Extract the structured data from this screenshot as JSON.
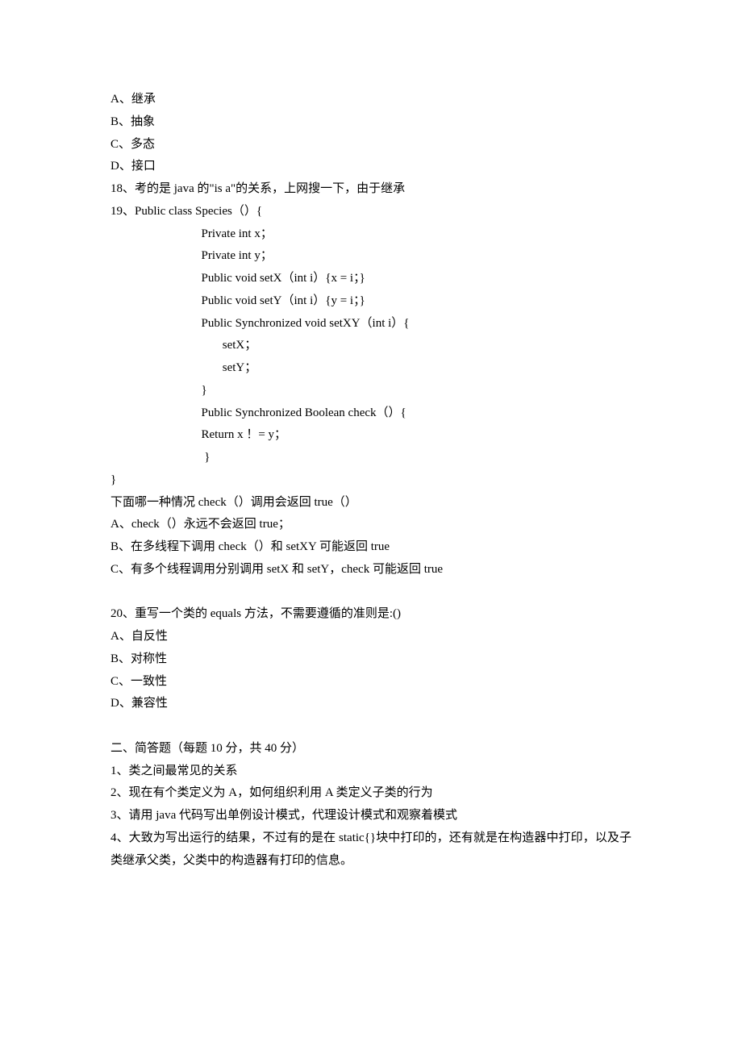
{
  "lines": {
    "l01": "A、继承",
    "l02": "B、抽象",
    "l03": "C、多态",
    "l04": "D、接口",
    "l05": "18、考的是 java 的\"is a\"的关系，上网搜一下，由于继承",
    "l06": "19、Public class Species（）{",
    "l07": "Private int x；",
    "l08": "Private int y；",
    "l09": "Public void setX（int i）{x = i；}",
    "l10": "Public void setY（int i）{y = i；}",
    "l11": "Public Synchronized void setXY（int i）{",
    "l12": " setX；",
    "l13": " setY；",
    "l14": "}",
    "l15": "Public Synchronized Boolean check（）{",
    "l16": "Return x ！= y；",
    "l17": " }",
    "l18": "}",
    "l19": "下面哪一种情况 check（）调用会返回 true（）",
    "l20": "A、check（）永远不会返回 true；",
    "l21": "B、在多线程下调用 check（）和 setXY 可能返回 true",
    "l22": "C、有多个线程调用分别调用 setX 和 setY，check 可能返回 true",
    "l23": "20、重写一个类的 equals 方法，不需要遵循的准则是:()",
    "l24": "A、自反性",
    "l25": "B、对称性",
    "l26": "C、一致性",
    "l27": "D、兼容性",
    "l28": "二、简答题（每题 10 分，共 40 分）",
    "l29": "1、类之间最常见的关系",
    "l30": "2、现在有个类定义为 A，如何组织利用 A 类定义子类的行为",
    "l31": "3、请用 java 代码写出单例设计模式，代理设计模式和观察着模式",
    "l32": "4、大致为写出运行的结果，不过有的是在 static{}块中打印的，还有就是在构造器中打印，以及子类继承父类，父类中的构造器有打印的信息。"
  }
}
